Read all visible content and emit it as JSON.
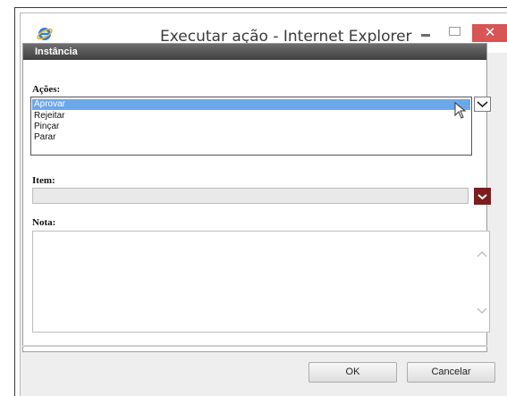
{
  "window": {
    "title": "Executar ação - Internet Explorer",
    "close_glyph": "✕",
    "accent_close": "#d95454"
  },
  "panel": {
    "header": "Instância"
  },
  "acoes": {
    "label": "Ações:",
    "options": [
      "Aprovar",
      "Rejeitar",
      "Pinçar",
      "Parar"
    ],
    "selected": "Aprovar",
    "highlight_color": "#6ba8ea"
  },
  "item": {
    "label": "Item:",
    "value": "",
    "dropdown_color": "#7a1e1e"
  },
  "nota": {
    "label": "Nota:",
    "value": ""
  },
  "buttons": {
    "ok": "OK",
    "cancel": "Cancelar"
  },
  "icons": {
    "app": "internet-explorer-icon",
    "cursor": "mouse-pointer-icon",
    "dropdown": "chevron-down-icon",
    "scroll_up": "chevron-up-icon",
    "scroll_down": "chevron-down-icon"
  }
}
